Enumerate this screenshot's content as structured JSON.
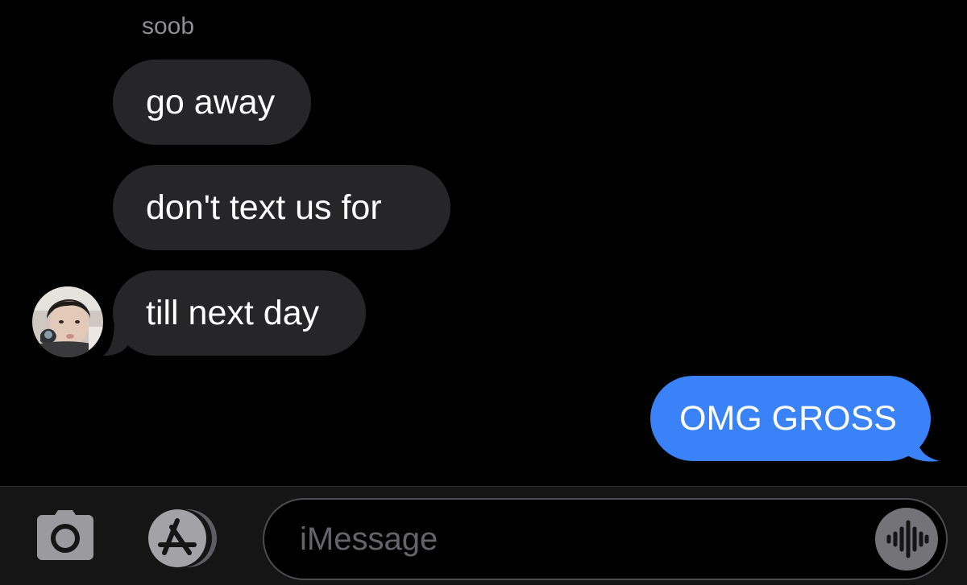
{
  "conversation": {
    "sender_name": "soob",
    "messages": [
      {
        "direction": "incoming",
        "text": "go away"
      },
      {
        "direction": "incoming",
        "text": "don't text us for"
      },
      {
        "direction": "incoming",
        "text": "till next day"
      },
      {
        "direction": "outgoing",
        "text": "OMG GROSS"
      }
    ]
  },
  "input_bar": {
    "placeholder": "iMessage",
    "icons": [
      "camera-icon",
      "app-store-icon",
      "audio-waveform-icon"
    ]
  },
  "colors": {
    "background": "#000000",
    "incoming_bubble": "#262629",
    "outgoing_bubble": "#3a82f7",
    "sender_name": "#8e8e93",
    "placeholder": "#656569"
  }
}
